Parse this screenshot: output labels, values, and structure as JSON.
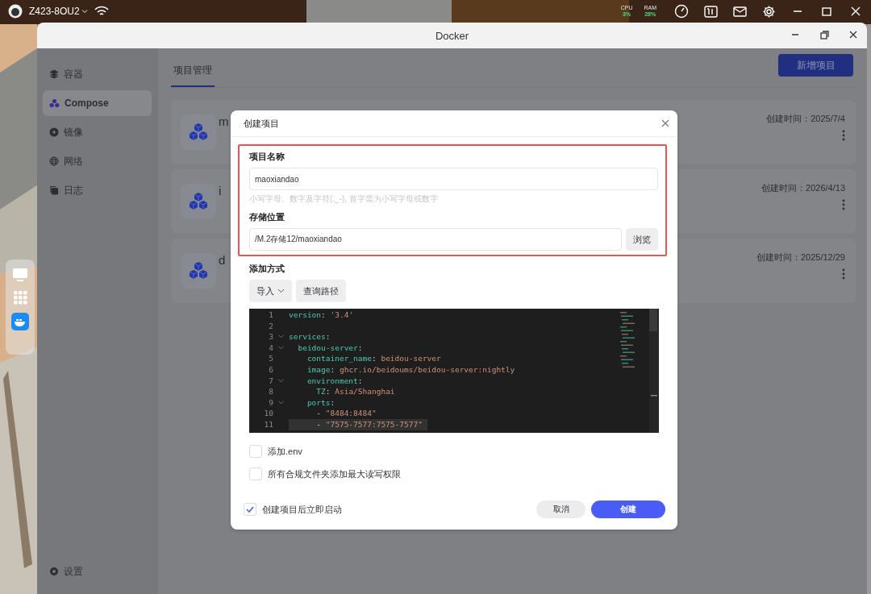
{
  "top_bar": {
    "device": "Z423-8OU2",
    "cpu": {
      "label": "CPU",
      "value": "3%"
    },
    "ram": {
      "label": "RAM",
      "value": "28%"
    }
  },
  "window": {
    "title": "Docker"
  },
  "sidebar": {
    "items": [
      {
        "label": "容器",
        "selected": false
      },
      {
        "label": "Compose",
        "selected": true
      },
      {
        "label": "镜像",
        "selected": false
      },
      {
        "label": "网络",
        "selected": false
      },
      {
        "label": "日志",
        "selected": false
      }
    ],
    "footer": {
      "label": "设置"
    }
  },
  "tabs": [
    {
      "label": "项目管理",
      "selected": true
    }
  ],
  "new_button": "新增项目",
  "projects": [
    {
      "name": "m",
      "created": "创建时间：2025/7/4"
    },
    {
      "name": "i",
      "created": "创建时间：2026/4/13"
    },
    {
      "name": "d",
      "created": "创建时间：2025/12/29"
    }
  ],
  "dialog": {
    "title": "创建项目",
    "name_label": "项目名称",
    "name_value": "maoxiandao",
    "name_hint": "小写字母、数字及字符(._-), 首字需为小写字母或数字",
    "path_label": "存储位置",
    "path_value": "/M.2存储12/maoxiandao",
    "browse": "浏览",
    "method_label": "添加方式",
    "import_button": "导入",
    "query_button": "查询路径",
    "code": [
      {
        "number": "1",
        "foldable": false,
        "active": false,
        "parts": [
          {
            "kind": "key",
            "text": "version"
          },
          {
            "kind": "punct",
            "text": ": "
          },
          {
            "kind": "value",
            "text": "'3.4'"
          }
        ]
      },
      {
        "number": "2",
        "foldable": false,
        "active": false
      },
      {
        "number": "3",
        "foldable": true,
        "active": false,
        "parts": [
          {
            "kind": "key",
            "text": "services"
          },
          {
            "kind": "punct",
            "text": ":"
          }
        ]
      },
      {
        "number": "4",
        "foldable": true,
        "active": false,
        "parts": [
          {
            "kind": "key",
            "text": "  beidou-server"
          },
          {
            "kind": "punct",
            "text": ":"
          }
        ]
      },
      {
        "number": "5",
        "foldable": false,
        "active": false,
        "parts": [
          {
            "kind": "key",
            "text": "    container_name"
          },
          {
            "kind": "punct",
            "text": ": "
          },
          {
            "kind": "value",
            "text": "beidou-server"
          }
        ]
      },
      {
        "number": "6",
        "foldable": false,
        "active": false,
        "parts": [
          {
            "kind": "key",
            "text": "    image"
          },
          {
            "kind": "punct",
            "text": ": "
          },
          {
            "kind": "value",
            "text": "ghcr.io/beidoums/beidou-server:nightly"
          }
        ]
      },
      {
        "number": "7",
        "foldable": true,
        "active": false,
        "parts": [
          {
            "kind": "key",
            "text": "    environment"
          },
          {
            "kind": "punct",
            "text": ":"
          }
        ]
      },
      {
        "number": "8",
        "foldable": false,
        "active": false,
        "parts": [
          {
            "kind": "key",
            "text": "      TZ"
          },
          {
            "kind": "punct",
            "text": ": "
          },
          {
            "kind": "value",
            "text": "Asia/Shanghai"
          }
        ]
      },
      {
        "number": "9",
        "foldable": true,
        "active": false,
        "parts": [
          {
            "kind": "key",
            "text": "    ports"
          },
          {
            "kind": "punct",
            "text": ":"
          }
        ]
      },
      {
        "number": "10",
        "foldable": false,
        "active": false,
        "parts": [
          {
            "kind": "punct",
            "text": "      - "
          },
          {
            "kind": "value",
            "text": "\"8484:8484\""
          }
        ]
      },
      {
        "number": "11",
        "foldable": false,
        "active": true,
        "parts": [
          {
            "kind": "punct",
            "text": "      - "
          },
          {
            "kind": "value",
            "text": "\"7575-7577:7575-7577\""
          }
        ]
      }
    ],
    "options": [
      {
        "label": "添加.env",
        "checked": false
      },
      {
        "label": "所有合规文件夹添加最大读写权限",
        "checked": false
      }
    ],
    "autostart": {
      "label": "创建项目后立即启动",
      "checked": true
    },
    "cancel": "取消",
    "create": "创建"
  }
}
